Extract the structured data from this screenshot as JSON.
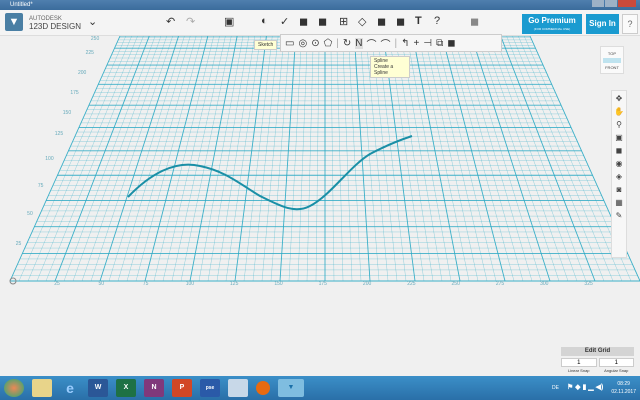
{
  "window": {
    "title": "Untitled*"
  },
  "app": {
    "brand_top": "AUTODESK",
    "brand_name": "123D DESIGN"
  },
  "header": {
    "premium_label": "Go Premium",
    "premium_sub": "(FOR COMMERCIAL USE)",
    "signin_label": "Sign In",
    "help_label": "?"
  },
  "tooltips": {
    "sketch": "Sketch",
    "spline_title": "Spline",
    "spline_desc": "Create a Spline"
  },
  "viewcube": {
    "top": "TOP",
    "front": "FRONT"
  },
  "grid": {
    "left_labels": [
      "250",
      "225",
      "200",
      "175",
      "150",
      "125",
      "100",
      "75",
      "50",
      "25"
    ],
    "bottom_labels": [
      "25",
      "50",
      "75",
      "100",
      "125",
      "150",
      "175",
      "200",
      "225",
      "250",
      "275",
      "300",
      "325"
    ],
    "color": "#2aa9c4"
  },
  "edit_grid": {
    "title": "Edit Grid",
    "linear_value": "1",
    "linear_label": "Linear Snap",
    "angular_value": "1",
    "angular_label": "Angular Snap"
  },
  "taskbar": {
    "apps": [
      "start",
      "explorer",
      "ie",
      "word",
      "excel",
      "onenote",
      "powerpoint",
      "pse",
      "file",
      "media",
      "123d"
    ],
    "lang": "DE",
    "time": "08:29",
    "date": "02.11.2017"
  }
}
